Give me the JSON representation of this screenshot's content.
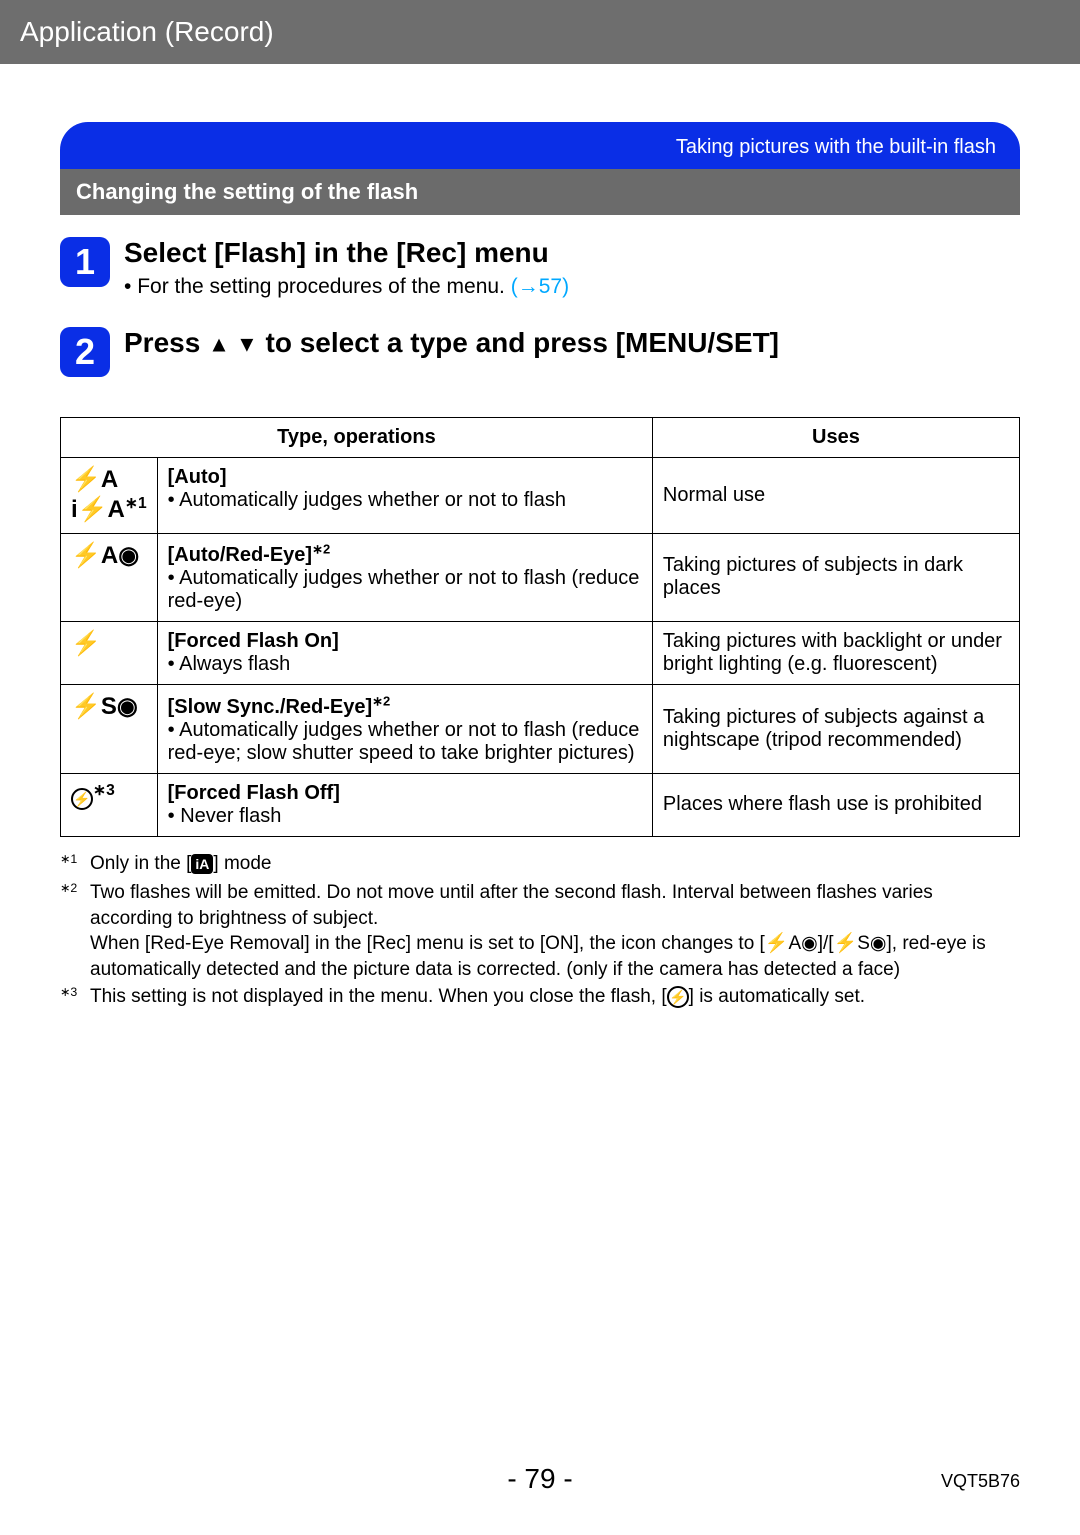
{
  "header": {
    "title": "Application (Record)"
  },
  "banner": {
    "text": "Taking pictures with the built-in flash"
  },
  "subheader": {
    "text": "Changing the setting of the flash"
  },
  "steps": [
    {
      "num": "1",
      "title": "Select [Flash] in the [Rec] menu",
      "bullet_prefix": "For the setting procedures of the menu. ",
      "link": "(→57)"
    },
    {
      "num": "2",
      "title_part1": "Press ",
      "title_part2": " to select a type and press [MENU/SET]"
    }
  ],
  "table": {
    "headers": {
      "type": "Type, operations",
      "uses": "Uses"
    },
    "rows": [
      {
        "icon1": "⚡A",
        "icon2_prefix": "i",
        "icon2_main": "⚡A",
        "icon2_sup": "∗1",
        "name": "[Auto]",
        "desc": "Automatically judges whether or not to flash",
        "uses": "Normal use"
      },
      {
        "icon": "⚡A◉",
        "name": "[Auto/Red-Eye]",
        "name_sup": "∗2",
        "desc": "Automatically judges whether or not to flash (reduce red-eye)",
        "uses": "Taking pictures of subjects in dark places"
      },
      {
        "icon": "⚡",
        "name": "[Forced Flash On]",
        "desc": "Always flash",
        "uses": "Taking pictures with backlight or under bright lighting (e.g. fluorescent)"
      },
      {
        "icon": "⚡S◉",
        "name": "[Slow Sync./Red-Eye]",
        "name_sup": "∗2",
        "desc": "Automatically judges whether or not to flash (reduce red-eye; slow shutter speed to take brighter pictures)",
        "uses": "Taking pictures of subjects against a nightscape (tripod recommended)"
      },
      {
        "icon_sup": "∗3",
        "name": "[Forced Flash Off]",
        "desc": "Never flash",
        "uses": "Places where flash use is prohibited"
      }
    ]
  },
  "footnotes": {
    "f1": {
      "ast": "∗1",
      "p1": "Only in the [",
      "badge": "iA",
      "p2": "] mode"
    },
    "f2": {
      "ast": "∗2",
      "line1": "Two flashes will be emitted. Do not move until after the second flash. Interval between flashes varies according to brightness of subject.",
      "line2a": "When [Red-Eye Removal] in the [Rec] menu is set to [ON], the icon changes to [",
      "ic1": "⚡A◉",
      "sep": "]/[",
      "ic2": "⚡S◉",
      "line2b": "], red-eye is automatically detected and the picture data is corrected. (only if the camera has detected a face)"
    },
    "f3": {
      "ast": "∗3",
      "p1": "This setting is not displayed in the menu. When you close the flash, [",
      "p2": "] is automatically set."
    }
  },
  "footer": {
    "page": "- 79 -",
    "code": "VQT5B76"
  }
}
